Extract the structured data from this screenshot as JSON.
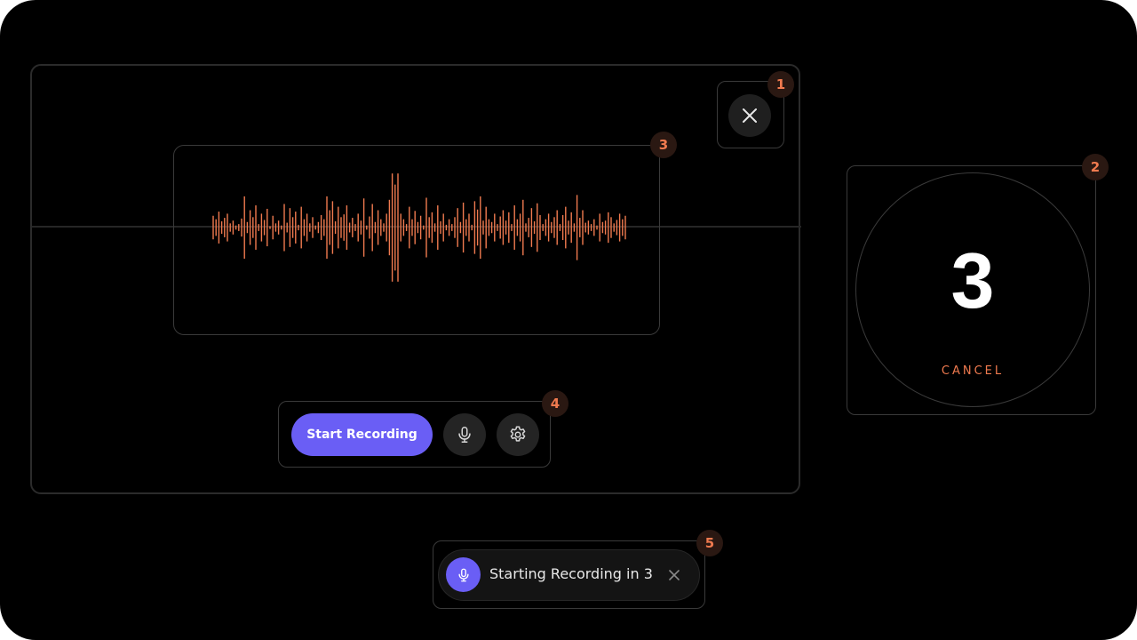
{
  "annotations": [
    "1",
    "2",
    "3",
    "4",
    "5"
  ],
  "recorder": {
    "start_label": "Start Recording",
    "icons": {
      "close": "close-icon",
      "mic": "microphone-icon",
      "settings": "gear-icon"
    }
  },
  "countdown": {
    "number": "3",
    "cancel_label": "CANCEL"
  },
  "toast": {
    "message": "Starting Recording in 3",
    "icons": {
      "mic": "microphone-icon",
      "close": "close-icon"
    }
  },
  "colors": {
    "accent": "#6a5ef5",
    "waveform": "#f07a4f",
    "badge_text": "#f07a4f",
    "background": "#000000"
  },
  "waveform": {
    "levels": [
      0.17,
      0.12,
      0.23,
      0.09,
      0.14,
      0.2,
      0.06,
      0.1,
      0.03,
      0.05,
      0.13,
      0.45,
      0.08,
      0.25,
      0.15,
      0.32,
      0.05,
      0.2,
      0.11,
      0.27,
      0.02,
      0.17,
      0.06,
      0.1,
      0.03,
      0.34,
      0.07,
      0.28,
      0.15,
      0.23,
      0.04,
      0.3,
      0.12,
      0.2,
      0.06,
      0.15,
      0.03,
      0.08,
      0.18,
      0.12,
      0.45,
      0.25,
      0.38,
      0.09,
      0.3,
      0.15,
      0.19,
      0.32,
      0.07,
      0.14,
      0.05,
      0.2,
      0.1,
      0.42,
      0.03,
      0.16,
      0.34,
      0.08,
      0.25,
      0.12,
      0.06,
      0.2,
      0.4,
      0.78,
      0.62,
      0.78,
      0.2,
      0.12,
      0.05,
      0.3,
      0.12,
      0.24,
      0.08,
      0.17,
      0.03,
      0.43,
      0.15,
      0.22,
      0.06,
      0.32,
      0.09,
      0.2,
      0.04,
      0.12,
      0.05,
      0.15,
      0.28,
      0.08,
      0.36,
      0.12,
      0.2,
      0.04,
      0.38,
      0.26,
      0.45,
      0.1,
      0.3,
      0.12,
      0.08,
      0.2,
      0.05,
      0.16,
      0.25,
      0.1,
      0.22,
      0.05,
      0.32,
      0.12,
      0.2,
      0.4,
      0.06,
      0.14,
      0.28,
      0.09,
      0.35,
      0.18,
      0.05,
      0.12,
      0.2,
      0.08,
      0.15,
      0.25,
      0.05,
      0.18,
      0.3,
      0.1,
      0.22,
      0.06,
      0.47,
      0.14,
      0.25,
      0.07,
      0.1,
      0.05,
      0.12,
      0.03,
      0.2,
      0.08,
      0.1,
      0.22,
      0.15,
      0.06,
      0.11,
      0.2,
      0.12,
      0.17
    ]
  }
}
